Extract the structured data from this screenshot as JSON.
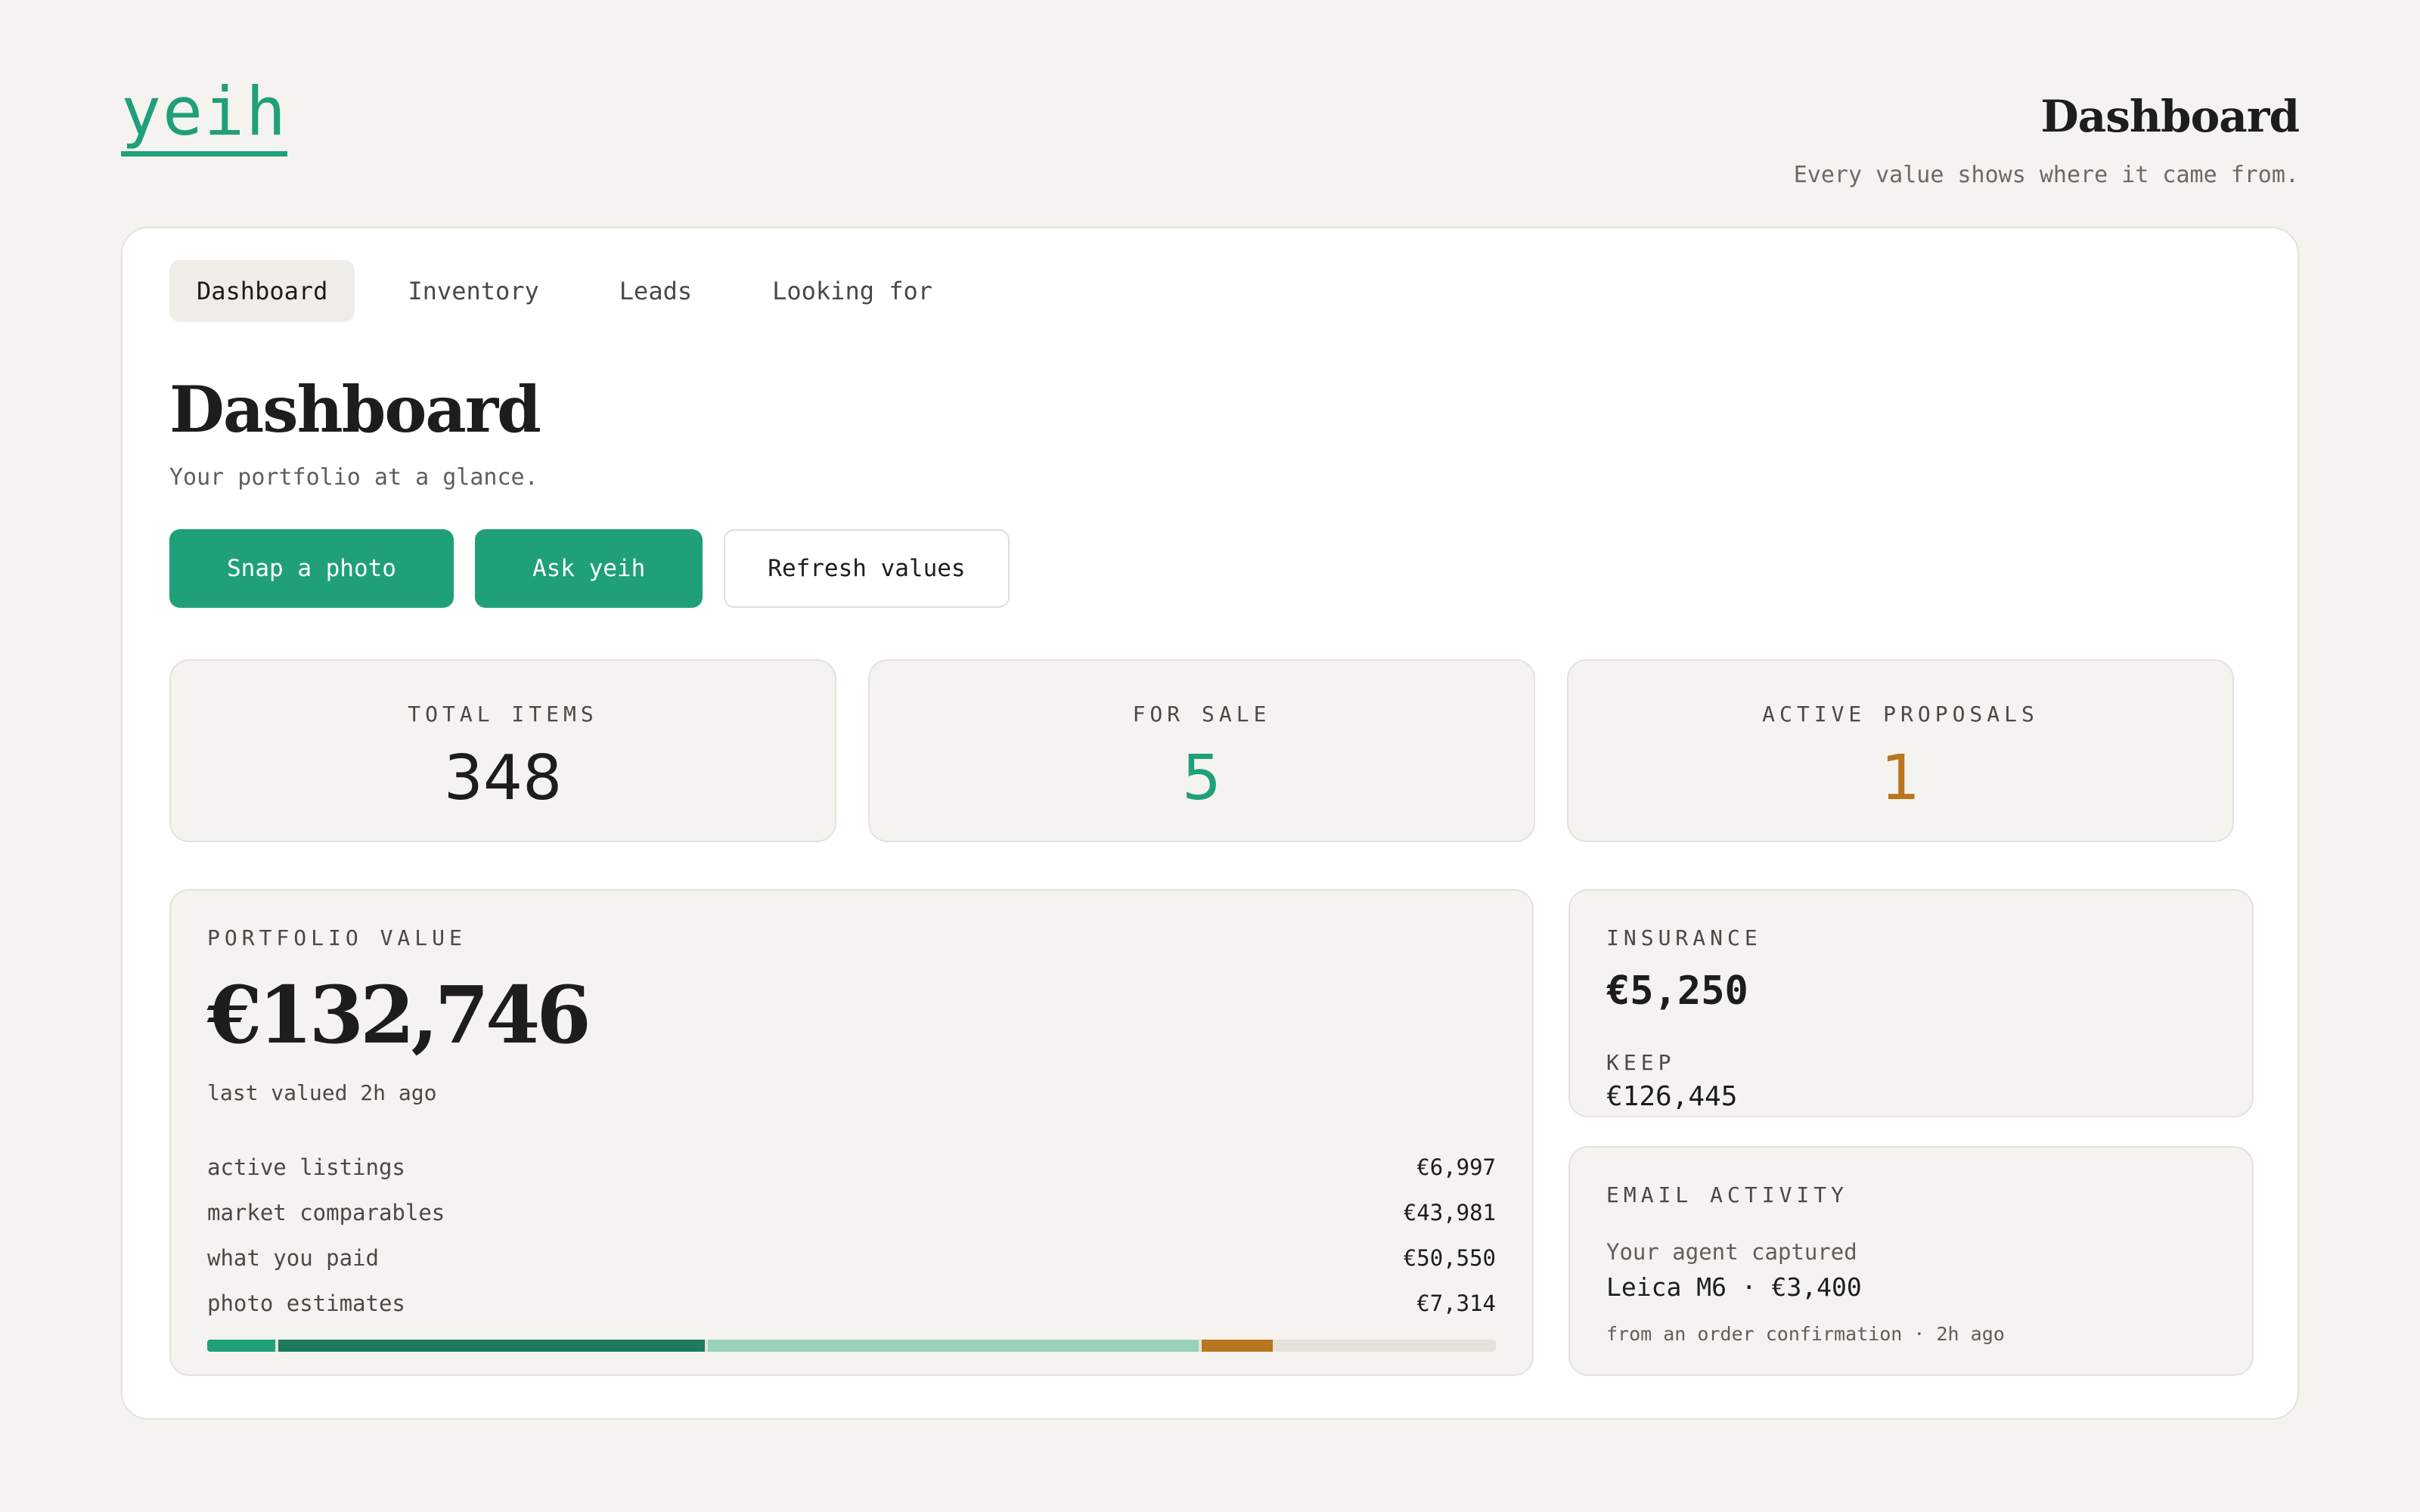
{
  "brand": {
    "logo": "yeih",
    "color": "#1fa078"
  },
  "header": {
    "title": "Dashboard",
    "subtitle": "Every value shows where it came from."
  },
  "tabs": [
    {
      "label": "Dashboard",
      "active": true
    },
    {
      "label": "Inventory",
      "active": false
    },
    {
      "label": "Leads",
      "active": false
    },
    {
      "label": "Looking for",
      "active": false
    }
  ],
  "page": {
    "title": "Dashboard",
    "subtitle": "Your portfolio at a glance."
  },
  "actions": {
    "snap": "Snap a photo",
    "ask": "Ask yeih",
    "refresh": "Refresh values"
  },
  "stats": [
    {
      "label": "TOTAL ITEMS",
      "value": "348",
      "color": "#1d1d1b"
    },
    {
      "label": "FOR SALE",
      "value": "5",
      "color": "#1fa078"
    },
    {
      "label": "ACTIVE PROPOSALS",
      "value": "1",
      "color": "#b8761f"
    }
  ],
  "portfolio": {
    "label": "PORTFOLIO VALUE",
    "value": "€132,746",
    "valued": "last valued 2h ago",
    "breakdown": [
      {
        "name": "active listings",
        "amount": "€6,997",
        "value": 6997,
        "color": "#1fa078"
      },
      {
        "name": "market comparables",
        "amount": "€43,981",
        "value": 43981,
        "color": "#1d7a5c"
      },
      {
        "name": "what you paid",
        "amount": "€50,550",
        "value": 50550,
        "color": "#98d2b9"
      },
      {
        "name": "photo estimates",
        "amount": "€7,314",
        "value": 7314,
        "color": "#b8761f"
      }
    ]
  },
  "insurance": {
    "label": "INSURANCE",
    "value": "€5,250",
    "keep_label": "KEEP",
    "keep_value": "€126,445"
  },
  "email": {
    "label": "EMAIL ACTIVITY",
    "pre": "Your agent captured",
    "item": "Leica M6 · €3,400",
    "source": "from an order confirmation · 2h ago"
  }
}
